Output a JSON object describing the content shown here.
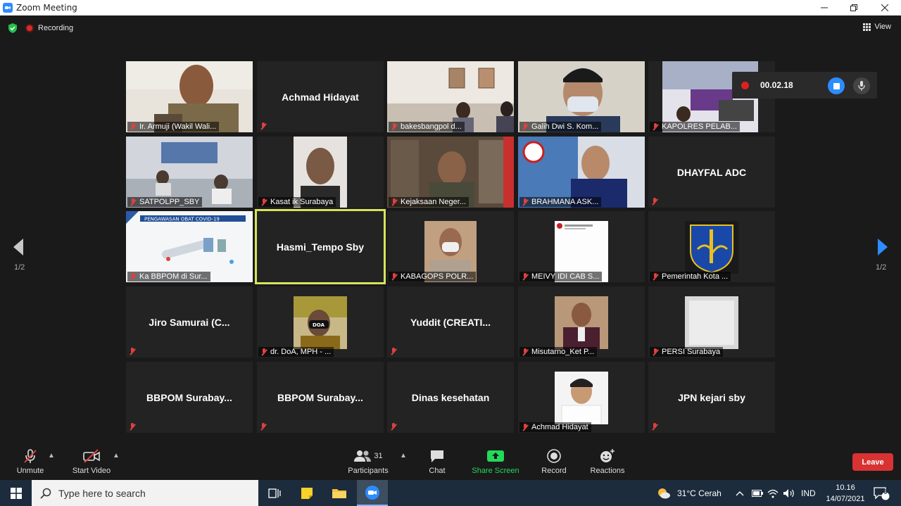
{
  "window": {
    "title": "Zoom Meeting"
  },
  "meeting_bar": {
    "recording_label": "Recording",
    "view_label": "View"
  },
  "tiles": [
    {
      "name": "Ir. Armuji (Wakil Wali...",
      "video": true
    },
    {
      "name": "Achmad Hidayat",
      "video": false
    },
    {
      "name": "bakesbangpol d...",
      "video": true
    },
    {
      "name": "Galih Dwi S. Kom...",
      "video": true
    },
    {
      "name": "KAPOLRES PELAB...",
      "video": true
    },
    {
      "name": "SATPOLPP_SBY",
      "video": true
    },
    {
      "name": "Kasat ik Surabaya",
      "video": true
    },
    {
      "name": "Kejaksaan Neger...",
      "video": true
    },
    {
      "name": "BRAHMANA ASK...",
      "video": true
    },
    {
      "name": "DHAYFAL ADC",
      "video": false
    },
    {
      "name": "Ka BBPOM di Sur...",
      "video": true
    },
    {
      "name": "Hasmi_Tempo Sby",
      "video": false,
      "active": true
    },
    {
      "name": "KABAGOPS POLR...",
      "video": true
    },
    {
      "name": "MEIVY IDI CAB S...",
      "video": true
    },
    {
      "name": "Pemerintah Kota ...",
      "video": true
    },
    {
      "name": "Jiro Samurai  (C...",
      "video": false
    },
    {
      "name": "dr. DoA, MPH - ...",
      "video": true
    },
    {
      "name": "Yuddit  (CREATI...",
      "video": false
    },
    {
      "name": "Misutarno_Ket P...",
      "video": true
    },
    {
      "name": "PERSI Surabaya",
      "video": true
    },
    {
      "name": "BBPOM  Surabay...",
      "video": false
    },
    {
      "name": "BBPOM  Surabay...",
      "video": false
    },
    {
      "name": "Dinas kesehatan",
      "video": false
    },
    {
      "name": "Achmad Hidayat",
      "video": true
    },
    {
      "name": "JPN kejari sby",
      "video": false
    }
  ],
  "thumb_texts": {
    "bbpom_banner": "PENGAWASAN OBAT COVID-19",
    "doa_mask": "DOA"
  },
  "pagination": {
    "left": "1/2",
    "right": "1/2"
  },
  "recording_widget": {
    "time": "00.02.18"
  },
  "toolbar": {
    "unmute": "Unmute",
    "start_video": "Start Video",
    "participants": "Participants",
    "participants_count": "31",
    "chat": "Chat",
    "share_screen": "Share Screen",
    "record": "Record",
    "reactions": "Reactions",
    "leave": "Leave"
  },
  "taskbar": {
    "search_placeholder": "Type here to search",
    "weather": "31°C  Cerah",
    "language": "IND",
    "time": "10.16",
    "date": "14/07/2021",
    "notifications": "9"
  },
  "colors": {
    "accent_blue": "#2d8cff",
    "share_green": "#23d959",
    "leave_red": "#d83232",
    "active_speaker": "#d7e35c",
    "muted_red": "#e04040"
  }
}
